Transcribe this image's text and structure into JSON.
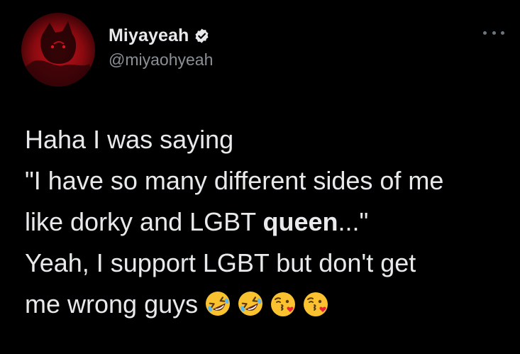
{
  "tweet": {
    "author": {
      "display_name": "Miyayeah",
      "handle": "@miyaohyeah",
      "verified": true,
      "avatar_colors": [
        "#c4101a",
        "#8a0a10",
        "#150102"
      ]
    },
    "more_icon": "more-horizontal-icon",
    "body": {
      "line1": "Haha I was saying",
      "line2": "\"I have so many different sides of me",
      "line3_pre": "like dorky and LGBT ",
      "line3_bold": "queen",
      "line3_post": "...\"",
      "line4": "Yeah, I support LGBT but don't get",
      "line5": "me wrong guys"
    },
    "emojis": [
      "rofl-emoji",
      "rofl-emoji",
      "kissing-heart-emoji",
      "kissing-heart-emoji"
    ],
    "colors": {
      "background": "#000000",
      "text": "#e7e9ea",
      "secondary": "#8b9096",
      "verified_badge": "#e7e9ea"
    }
  }
}
